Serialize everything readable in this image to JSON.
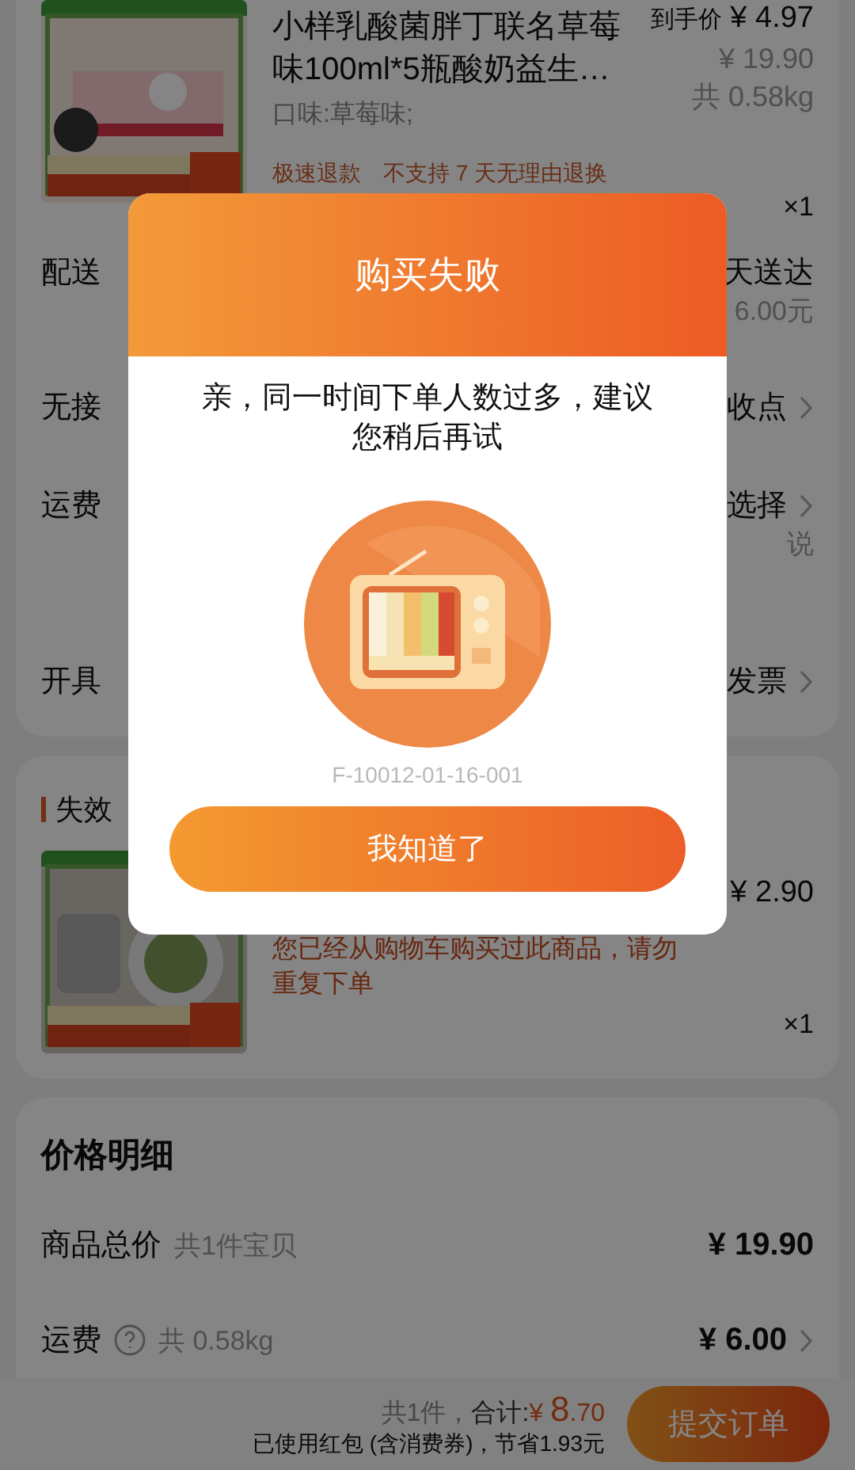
{
  "order_item": {
    "title": "小样乳酸菌胖丁联名草莓味100ml*5瓶酸奶益生…",
    "final_price_label": "到手价",
    "final_price": "¥ 4.97",
    "original_price": "¥ 19.90",
    "weight": "共 0.58kg",
    "spec": "口味:草莓味;",
    "tags": [
      "极速退款",
      "不支持 7 天无理由退换"
    ],
    "quantity": "×1"
  },
  "options": [
    {
      "label": "配送",
      "value": "天送达",
      "note": "6.00元",
      "chevron": false
    },
    {
      "label": "无接",
      "value": "收点",
      "chevron": true
    },
    {
      "label": "运费",
      "value": "选择",
      "note": "说",
      "chevron": true
    },
    {
      "label": "开具",
      "value": "发票",
      "chevron": true
    }
  ],
  "invalid_section": {
    "title": "失效",
    "item": {
      "price": "¥ 2.90",
      "message": "您已经从购物车购买过此商品，请勿重复下单",
      "quantity": "×1"
    }
  },
  "price_details": {
    "title": "价格明细",
    "rows": [
      {
        "label": "商品总价",
        "note": "共1件宝贝",
        "amount": "¥ 19.90",
        "kind": "plain",
        "chevron": false
      },
      {
        "label": "运费",
        "note": "共 0.58kg",
        "amount": "¥ 6.00",
        "kind": "help",
        "chevron": true
      }
    ]
  },
  "footer": {
    "count": "共1件，",
    "total_label": "合计:",
    "currency": "¥ ",
    "total_main": "8",
    "total_decimal": ".70",
    "savings": "已使用红包 (含消费券)，节省1.93元",
    "submit": "提交订单"
  },
  "dialog": {
    "title": "购买失败",
    "message": "亲，同一时间下单人数过多，建议您稍后再试",
    "error_code": "F-10012-01-16-001",
    "button": "我知道了"
  }
}
